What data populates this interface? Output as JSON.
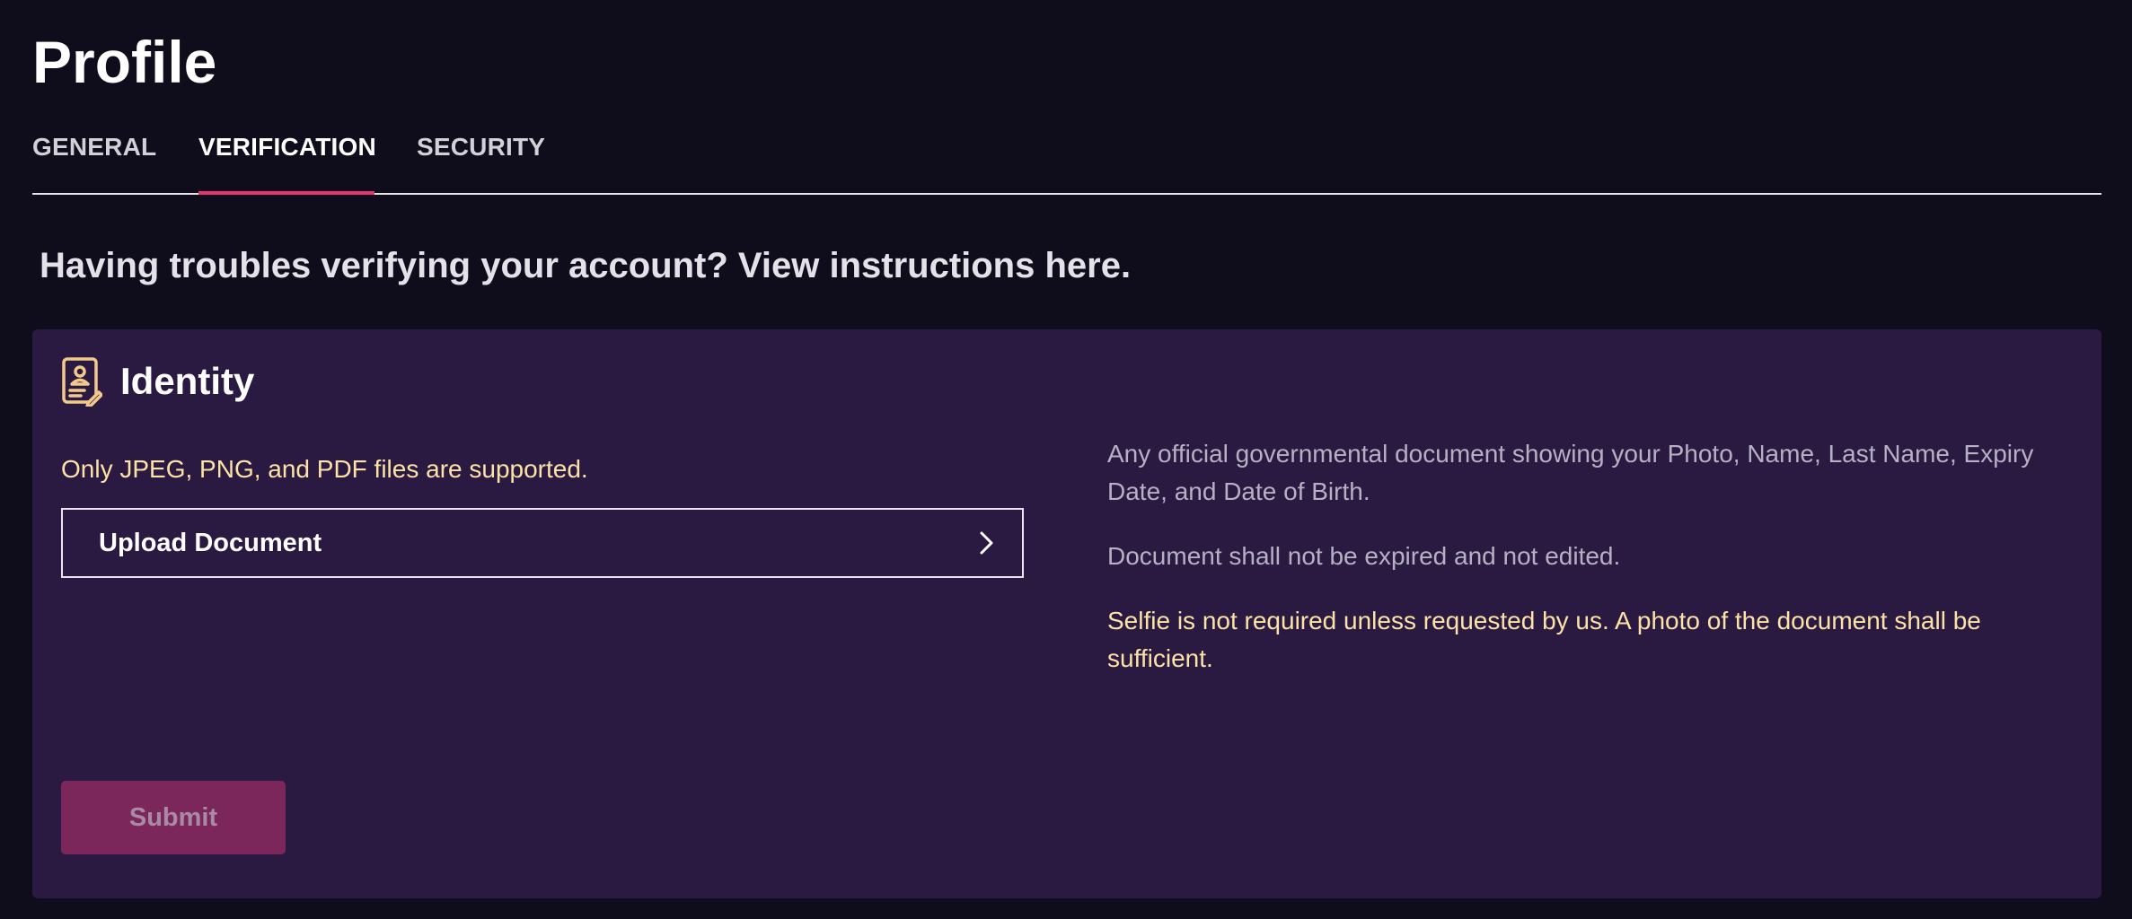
{
  "page": {
    "title": "Profile"
  },
  "tabs": [
    {
      "label": "GENERAL",
      "active": false
    },
    {
      "label": "VERIFICATION",
      "active": true
    },
    {
      "label": "SECURITY",
      "active": false
    }
  ],
  "help": {
    "text": "Having troubles verifying your account? View instructions here."
  },
  "identity": {
    "title": "Identity",
    "icon": "identity-document-icon",
    "formats_note": "Only JPEG, PNG, and PDF files are supported.",
    "upload_label": "Upload Document",
    "requirements": [
      "Any official governmental document showing your Photo, Name, Last Name, Expiry Date, and Date of Birth.",
      "Document shall not be expired and not edited.",
      "Selfie is not required unless requested by us. A photo of the document shall be sufficient."
    ],
    "submit_label": "Submit",
    "submit_disabled": true
  },
  "colors": {
    "background": "#0f0c1b",
    "card": "#2a1a42",
    "accent": "#e6366b",
    "warning_text": "#fde2a6",
    "submit_disabled": "#7c275c"
  }
}
